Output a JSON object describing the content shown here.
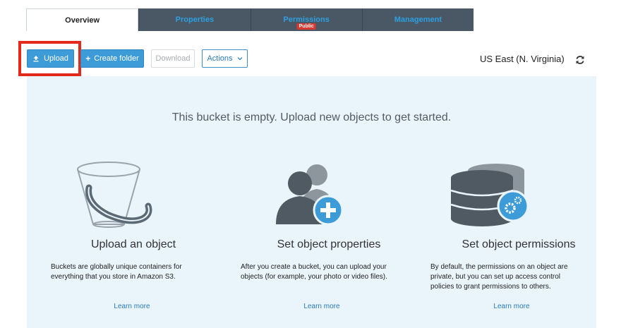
{
  "tabs": [
    {
      "label": "Overview",
      "active": true
    },
    {
      "label": "Properties",
      "active": false
    },
    {
      "label": "Permissions",
      "active": false,
      "badge": "Public"
    },
    {
      "label": "Management",
      "active": false
    }
  ],
  "toolbar": {
    "upload_label": "Upload",
    "upload_icon": "upload-icon",
    "create_folder_label": "Create folder",
    "create_folder_icon": "plus-icon",
    "download_label": "Download",
    "actions_label": "Actions",
    "actions_icon": "chevron-down-icon"
  },
  "region": {
    "label": "US East (N. Virginia)",
    "refresh_icon": "refresh-icon"
  },
  "main": {
    "empty_message": "This bucket is empty. Upload new objects to get started.",
    "columns": [
      {
        "icon": "bucket-icon",
        "title": "Upload an object",
        "description": "Buckets are globally unique containers for everything that you store in Amazon S3.",
        "link": "Learn more"
      },
      {
        "icon": "users-add-icon",
        "title": "Set object properties",
        "description": "After you create a bucket, you can upload your objects (for example, your photo or video files).",
        "link": "Learn more"
      },
      {
        "icon": "database-gear-icon",
        "title": "Set object permissions",
        "description": "By default, the permissions on an object are private, but you can set up access control policies to grant permissions to others.",
        "link": "Learn more"
      }
    ]
  },
  "colors": {
    "accent": "#3d9bd7",
    "tab_inactive_bg": "#4a5866",
    "tab_inactive_text": "#2c9fe0",
    "panel_bg": "#e9f4fb",
    "highlight": "#e3281c",
    "badge": "#d8382f"
  }
}
